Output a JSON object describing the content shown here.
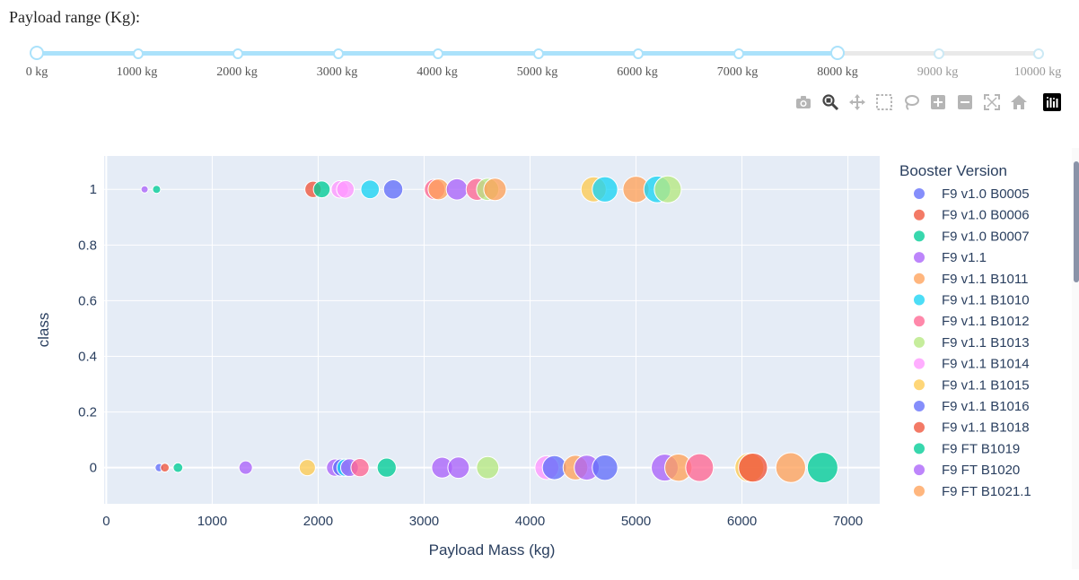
{
  "slider": {
    "label": "Payload range (Kg):",
    "min": 0,
    "max": 10000,
    "selected": [
      0,
      8000
    ],
    "marks": [
      "0 kg",
      "1000 kg",
      "2000 kg",
      "3000 kg",
      "4000 kg",
      "5000 kg",
      "6000 kg",
      "7000 kg",
      "8000 kg",
      "9000 kg",
      "10000 kg"
    ],
    "active_color": "#abe2fb",
    "inactive_color": "#e9e9e9"
  },
  "modebar": {
    "buttons": [
      "camera-icon",
      "zoom-icon",
      "pan-icon",
      "box-select-icon",
      "lasso-icon",
      "zoom-in-icon",
      "zoom-out-icon",
      "autoscale-icon",
      "home-icon",
      "plotly-logo-icon"
    ]
  },
  "chart_data": {
    "type": "scatter",
    "xlabel": "Payload Mass (kg)",
    "ylabel": "class",
    "xlim": [
      -20,
      7300
    ],
    "ylim": [
      -0.13,
      1.12
    ],
    "xticks": [
      "0",
      "1000",
      "2000",
      "3000",
      "4000",
      "5000",
      "6000",
      "7000"
    ],
    "yticks": [
      "0",
      "0.2",
      "0.4",
      "0.6",
      "0.8",
      "1"
    ],
    "grid": true,
    "plot_bg": "#e5ecf6",
    "legend": {
      "title": "Booster Version",
      "placement": "right",
      "entries": [
        {
          "name": "F9 v1.0  B0005",
          "color": "#636efa"
        },
        {
          "name": "F9 v1.0  B0006",
          "color": "#EF553B"
        },
        {
          "name": "F9 v1.0  B0007",
          "color": "#00cc96"
        },
        {
          "name": "F9 v1.1",
          "color": "#ab63fa"
        },
        {
          "name": "F9 v1.1 B1011",
          "color": "#FFA15A"
        },
        {
          "name": "F9 v1.1 B1010",
          "color": "#19d3f3"
        },
        {
          "name": "F9 v1.1 B1012",
          "color": "#FF6692"
        },
        {
          "name": "F9 v1.1 B1013",
          "color": "#B6E880"
        },
        {
          "name": "F9 v1.1 B1014",
          "color": "#FF97FF"
        },
        {
          "name": "F9 v1.1 B1015",
          "color": "#FECB52"
        },
        {
          "name": "F9 v1.1 B1016",
          "color": "#636efa"
        },
        {
          "name": "F9 v1.1 B1018",
          "color": "#EF553B"
        },
        {
          "name": "F9 FT B1019",
          "color": "#00cc96"
        },
        {
          "name": "F9 FT B1020",
          "color": "#ab63fa"
        },
        {
          "name": "F9 FT B1021.1",
          "color": "#FFA15A"
        }
      ]
    },
    "points": [
      {
        "x": 362,
        "y": 1,
        "c": "#ab63fa"
      },
      {
        "x": 475,
        "y": 1,
        "c": "#00cc96"
      },
      {
        "x": 1952,
        "y": 1,
        "c": "#EF553B"
      },
      {
        "x": 2034,
        "y": 1,
        "c": "#00cc96"
      },
      {
        "x": 2205,
        "y": 1,
        "c": "#FF97FF"
      },
      {
        "x": 2257,
        "y": 1,
        "c": "#FF97FF"
      },
      {
        "x": 2490,
        "y": 1,
        "c": "#19d3f3"
      },
      {
        "x": 2708,
        "y": 1,
        "c": "#636efa"
      },
      {
        "x": 3100,
        "y": 1,
        "c": "#FF6692"
      },
      {
        "x": 3136,
        "y": 1,
        "c": "#FFA15A"
      },
      {
        "x": 3310,
        "y": 1,
        "c": "#ab63fa"
      },
      {
        "x": 3500,
        "y": 1,
        "c": "#FF6692"
      },
      {
        "x": 3600,
        "y": 1,
        "c": "#B6E880"
      },
      {
        "x": 3669,
        "y": 1,
        "c": "#FFA15A"
      },
      {
        "x": 4600,
        "y": 1,
        "c": "#FECB52"
      },
      {
        "x": 4707,
        "y": 1,
        "c": "#19d3f3"
      },
      {
        "x": 5000,
        "y": 1,
        "c": "#FFA15A"
      },
      {
        "x": 5200,
        "y": 1,
        "c": "#19d3f3"
      },
      {
        "x": 5300,
        "y": 1,
        "c": "#B6E880"
      },
      {
        "x": 500,
        "y": 0,
        "c": "#636efa"
      },
      {
        "x": 553,
        "y": 0,
        "c": "#EF553B"
      },
      {
        "x": 677,
        "y": 0,
        "c": "#00cc96"
      },
      {
        "x": 1316,
        "y": 0,
        "c": "#ab63fa"
      },
      {
        "x": 1898,
        "y": 0,
        "c": "#FECB52"
      },
      {
        "x": 2160,
        "y": 0,
        "c": "#ab63fa"
      },
      {
        "x": 2220,
        "y": 0,
        "c": "#636efa"
      },
      {
        "x": 2260,
        "y": 0,
        "c": "#19d3f3"
      },
      {
        "x": 2296,
        "y": 0,
        "c": "#ab63fa"
      },
      {
        "x": 2395,
        "y": 0,
        "c": "#FF6692"
      },
      {
        "x": 2647,
        "y": 0,
        "c": "#00cc96"
      },
      {
        "x": 3170,
        "y": 0,
        "c": "#ab63fa"
      },
      {
        "x": 3325,
        "y": 0,
        "c": "#ab63fa"
      },
      {
        "x": 3600,
        "y": 0,
        "c": "#B6E880"
      },
      {
        "x": 4159,
        "y": 0,
        "c": "#FF97FF"
      },
      {
        "x": 4230,
        "y": 0,
        "c": "#636efa"
      },
      {
        "x": 4428,
        "y": 0,
        "c": "#FFA15A"
      },
      {
        "x": 4535,
        "y": 0,
        "c": "#ab63fa"
      },
      {
        "x": 4707,
        "y": 0,
        "c": "#636efa"
      },
      {
        "x": 5271,
        "y": 0,
        "c": "#ab63fa"
      },
      {
        "x": 5400,
        "y": 0,
        "c": "#FFA15A"
      },
      {
        "x": 5600,
        "y": 0,
        "c": "#FF6692"
      },
      {
        "x": 6070,
        "y": 0,
        "c": "#FECB52"
      },
      {
        "x": 6104,
        "y": 0,
        "c": "#EF553B"
      },
      {
        "x": 6460,
        "y": 0,
        "c": "#FFA15A"
      },
      {
        "x": 6761,
        "y": 0,
        "c": "#00cc96"
      }
    ]
  }
}
